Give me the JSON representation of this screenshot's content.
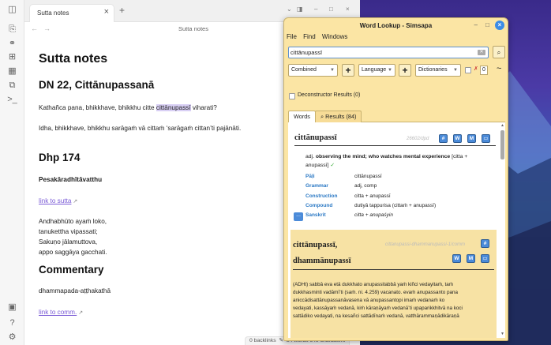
{
  "obsidian": {
    "tab_label": "Sutta notes",
    "tab_close": "×",
    "tab_plus": "+",
    "nav_back": "←",
    "nav_fwd": "→",
    "nav_title": "Sutta notes",
    "title": "Sutta notes",
    "h_dn": "DN 22, Cittānupassanā",
    "p1_before": "Kathañca pana, bhikkhave, bhikkhu citte ",
    "p1_hl": "cittānupassī",
    "p1_after": " viharati?",
    "p2": "Idha, bhikkhave, bhikkhu sarāgaṁ vā cittaṁ ‘sarāgaṁ cittan’ti pajānāti.",
    "h_dhp": "Dhp 174",
    "pesa": "Pesakāradhītāvatthu",
    "link_sutta": "link to sutta",
    "verse1": "Andhabhūto ayaṁ loko,",
    "verse2": "tanukettha vipassati;",
    "verse3": "Sakuṇo jālamuttova,",
    "verse4": "appo saggāya gacchati.",
    "h_comm": "Commentary",
    "dhammapada": "dhammapada-aṭṭhakathā",
    "link_comm": "link to comm.",
    "ext_icon": "↗",
    "status_backlinks": "0 backlinks",
    "status_words": "84 words",
    "status_chars": "649 characters"
  },
  "simsapa": {
    "title": "Word Lookup - Simsapa",
    "menu": [
      "File",
      "Find",
      "Windows"
    ],
    "menu_underline": [
      "F",
      "i",
      "W"
    ],
    "search_value": "cittānupassī",
    "search_mode": "Combined",
    "language": "Language",
    "dictionaries": "Dictionaries",
    "spin_value": "0",
    "deconstructor": "Deconstructor Results (0)",
    "tab_words": "Words",
    "tab_results": "Results (84)",
    "entry1": {
      "word": "cittānupassī",
      "source": "26602/dpd",
      "buttons": [
        "#",
        "W",
        "M",
        "▭"
      ],
      "gloss_pos": "adj.",
      "gloss_main": "observing the mind; who watches mental experience",
      "gloss_rest": "[citta +",
      "gloss_line2": "anupassī]",
      "check": "✓",
      "rows": [
        {
          "k": "Pāḷi",
          "v": "cittānupassī"
        },
        {
          "k": "Grammar",
          "v": "adj, comp"
        },
        {
          "k": "Construction",
          "v": "citta + anupassī"
        },
        {
          "k": "Compound",
          "v": "dutiyā tappurisa (cittaṁ + anupassī)"
        },
        {
          "k": "Sanskrit",
          "v": "citta + anupaśyin"
        }
      ],
      "more": "..."
    },
    "entry2": {
      "word_line1": "cittānupassī,",
      "word_line2": "dhammānupassī",
      "source": "cittanupassi-dhammanupassi-1/comm",
      "buttons": [
        "#",
        "W",
        "M",
        "▭"
      ],
      "body": [
        "(ADHt) sabbā eva etā dukkhato anupassitabbā yaṁ kiñci vedayitaṁ, taṁ",
        "dukkhasminti vadāmī’ti (saṁ. ni. 4.259) vacanato. evaṁ anupassanto pana",
        "aniccādisattānupassanāvasena vā anupassantopi imaṁ vedanaṁ ko",
        "vedayati, kassāyaṁ vedanā, kiṁ kāraṇāyaṁ vedanā’ti upaparikkhitvā na koci",
        "sattādiko vedayati, na kesañci sattādīnaṁ vedanā, vatthārammaṇādikāraṇā"
      ]
    }
  }
}
